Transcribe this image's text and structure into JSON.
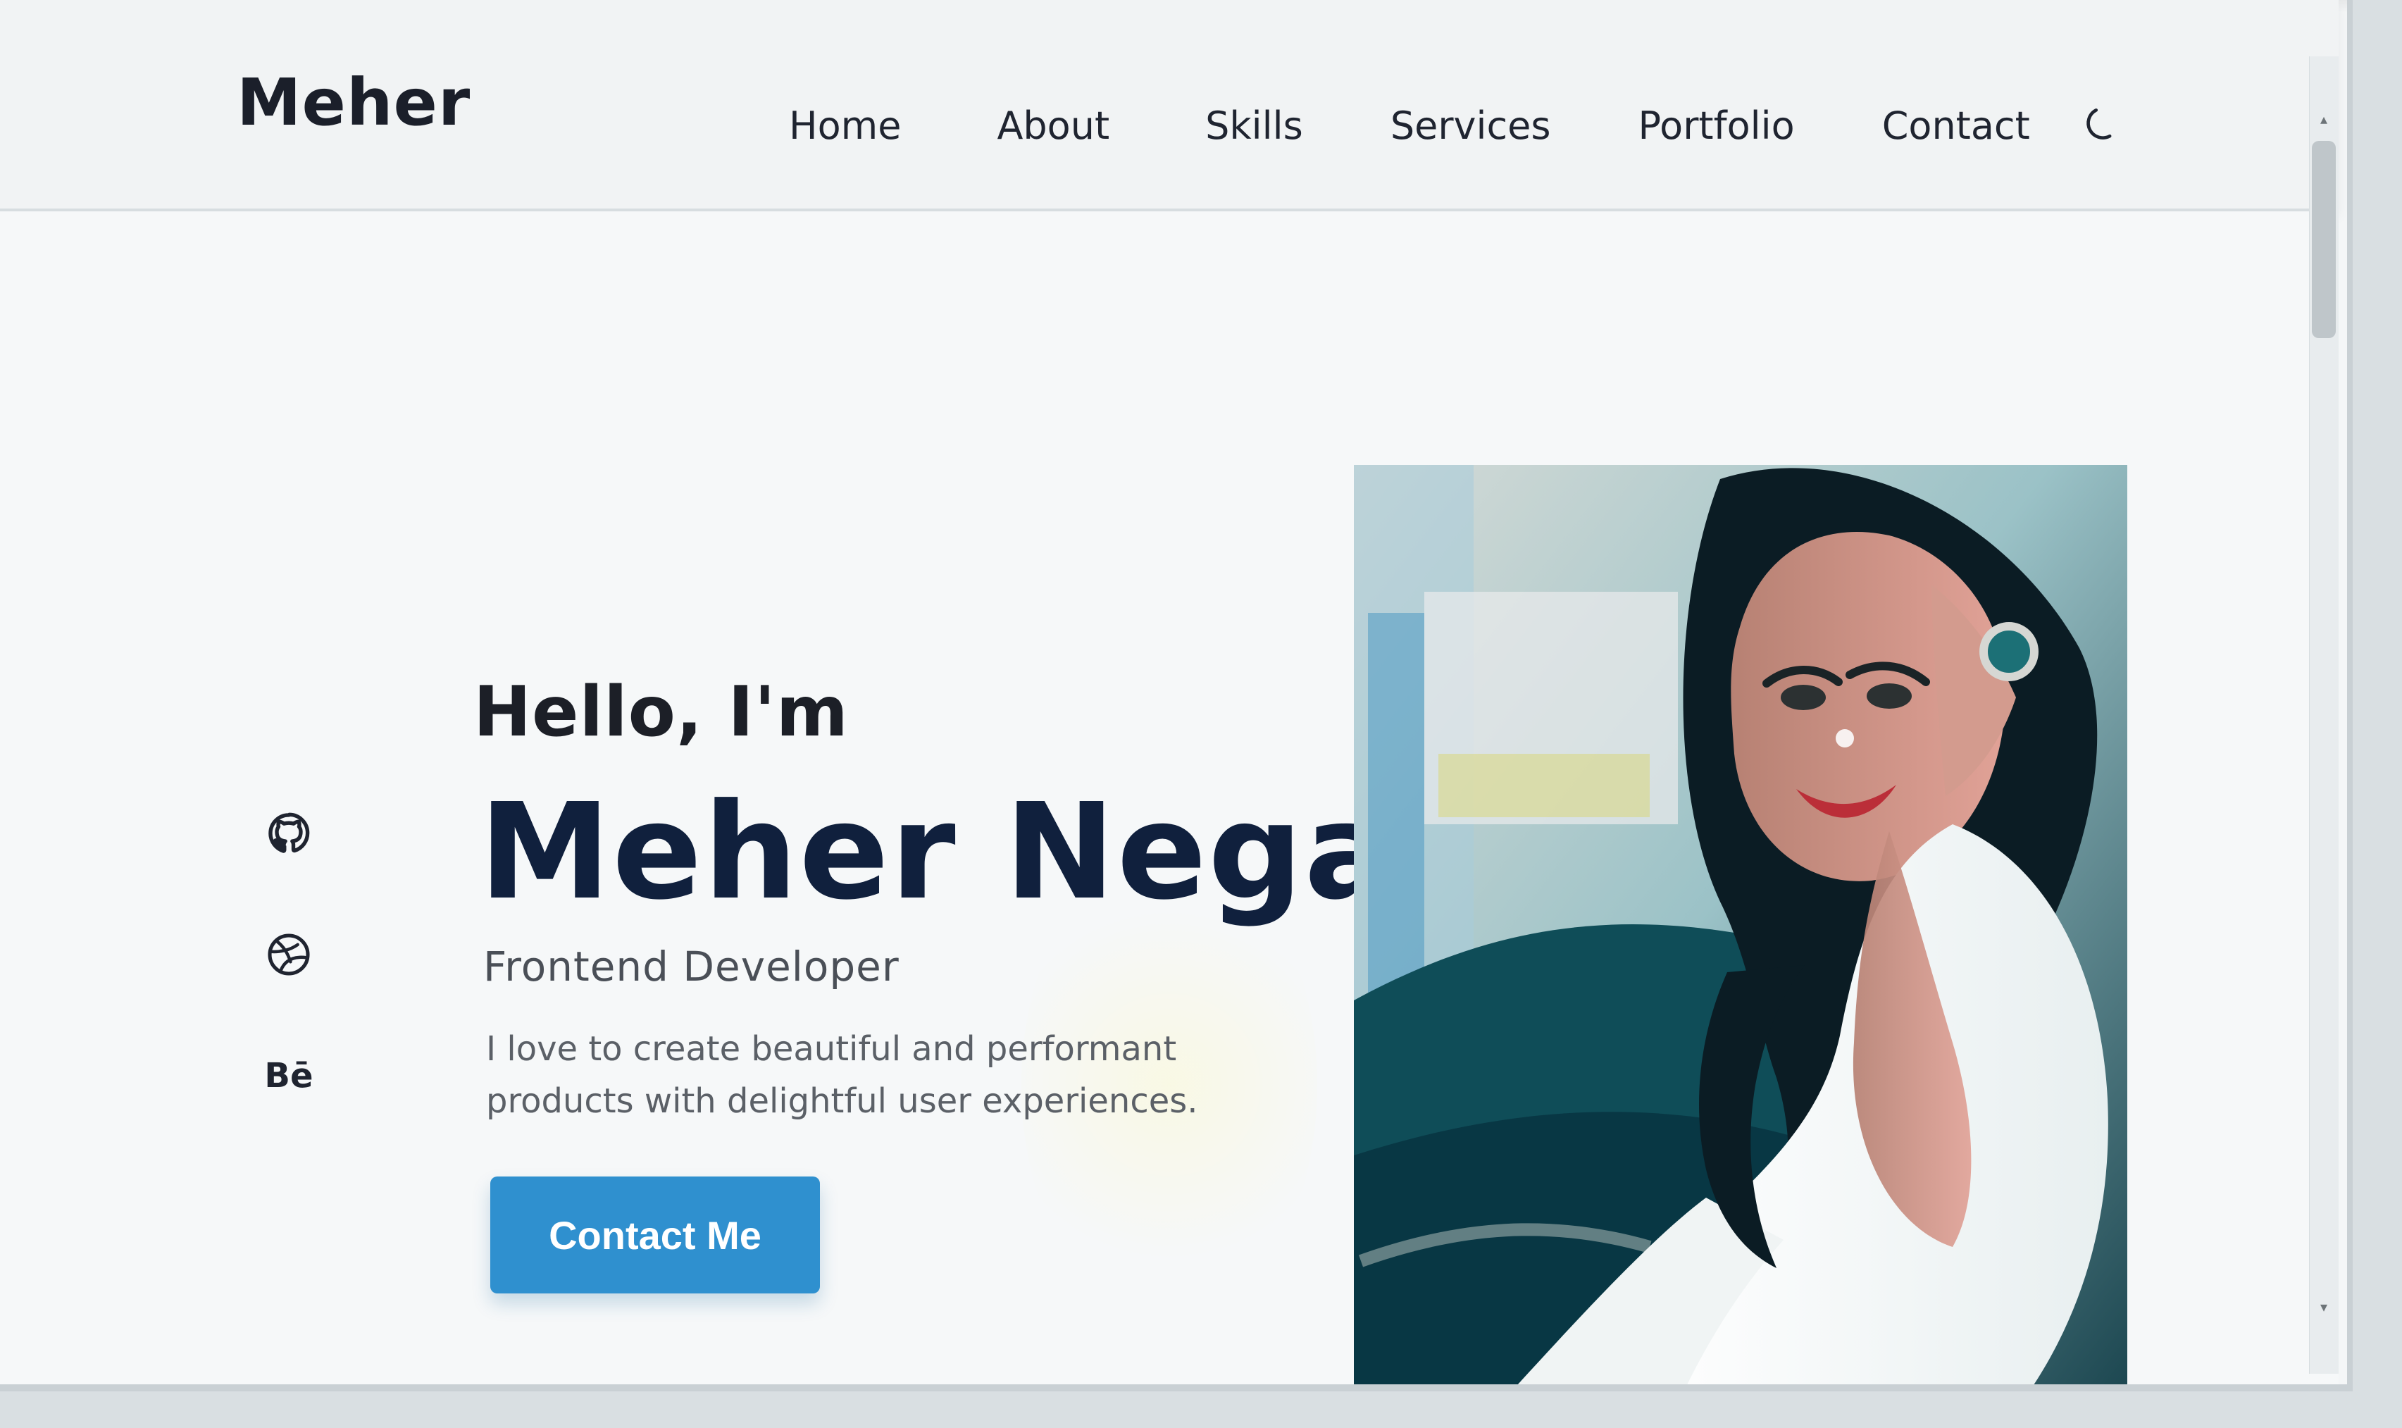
{
  "header": {
    "logo": "Meher",
    "nav": {
      "home": "Home",
      "about": "About",
      "skills": "Skills",
      "services": "Services",
      "portfolio": "Portfolio",
      "contact": "Contact"
    },
    "theme_icon": "moon-icon"
  },
  "hero": {
    "greeting": "Hello, I'm",
    "name": "Meher Negar",
    "role": "Frontend Developer",
    "description_line_1": "I love to create beautiful and performant",
    "description_line_2": "products with delightful user experiences.",
    "cta_label": "Contact Me",
    "social": {
      "github_icon": "github-icon",
      "dribbble_icon": "dribbble-icon",
      "behance_label": "Bē"
    }
  },
  "colors": {
    "primary": "#2f90cf",
    "dark_text": "#10203d",
    "body_text": "#4a4f57",
    "background": "#f6f8f9"
  }
}
